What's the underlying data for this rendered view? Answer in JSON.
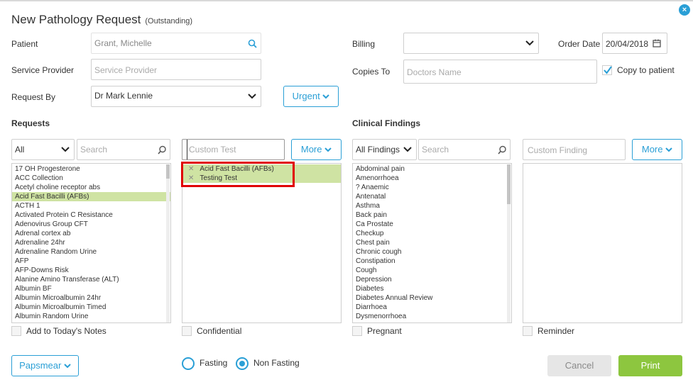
{
  "dialog": {
    "title": "New Pathology Request",
    "subtitle": "(Outstanding)",
    "close_icon": "×"
  },
  "form": {
    "patient_label": "Patient",
    "patient_value": "Grant, Michelle",
    "service_provider_label": "Service Provider",
    "service_provider_placeholder": "Service Provider",
    "request_by_label": "Request By",
    "request_by_value": "Dr Mark Lennie",
    "urgent_label": "Urgent",
    "billing_label": "Billing",
    "billing_value": "",
    "order_date_label": "Order Date",
    "order_date_value": "20/04/2018",
    "copies_to_label": "Copies To",
    "copies_to_placeholder": "Doctors Name",
    "copy_to_patient_label": "Copy to patient"
  },
  "requests": {
    "heading": "Requests",
    "filter_value": "All",
    "search_placeholder": "Search",
    "custom_test_placeholder": "Custom Test",
    "more_label": "More",
    "items": [
      "17 OH Progesterone",
      "ACC Collection",
      "Acetyl choline receptor abs",
      "Acid Fast Bacilli (AFBs)",
      "ACTH 1",
      "Activated Protein C Resistance",
      "Adenovirus Group CFT",
      "Adrenal cortex ab",
      "Adrenaline 24hr",
      "Adrenaline Random Urine",
      "AFP",
      "AFP-Downs Risk",
      "Alanine Amino Transferase (ALT)",
      "Albumin BF",
      "Albumin Microalbumin 24hr",
      "Albumin Microalbumin Timed",
      "Albumin Random Urine"
    ],
    "selected_item": "Acid Fast Bacilli (AFBs)",
    "selected_tests": [
      "Acid Fast Bacilli (AFBs)",
      "Testing Test"
    ],
    "add_to_notes_label": "Add to Today's Notes",
    "confidential_label": "Confidential"
  },
  "clinical": {
    "heading": "Clinical Findings",
    "filter_value": "All Findings",
    "search_placeholder": "Search",
    "custom_finding_placeholder": "Custom Finding",
    "more_label": "More",
    "items": [
      "Abdominal pain",
      "Amenorrhoea",
      "? Anaemic",
      "Antenatal",
      "Asthma",
      "Back pain",
      "Ca Prostate",
      "Checkup",
      "Chest pain",
      "Chronic cough",
      "Constipation",
      "Cough",
      "Depression",
      "Diabetes",
      "Diabetes Annual Review",
      "Diarrhoea",
      "Dysmenorrhoea"
    ],
    "pregnant_label": "Pregnant",
    "reminder_label": "Reminder"
  },
  "footer": {
    "papsmear_label": "Papsmear",
    "fasting_label": "Fasting",
    "non_fasting_label": "Non Fasting",
    "fasting_selected": "Non Fasting",
    "cancel_label": "Cancel",
    "print_label": "Print"
  },
  "colors": {
    "accent": "#2a9fd6",
    "selection": "#cfe3a3",
    "print": "#8dc63f",
    "highlight": "#e00000"
  },
  "icons": {
    "close": "close-icon",
    "search": "search-icon",
    "calendar": "calendar-icon",
    "chevron": "chevron-down-icon",
    "check": "check-icon",
    "remove": "remove-icon"
  }
}
